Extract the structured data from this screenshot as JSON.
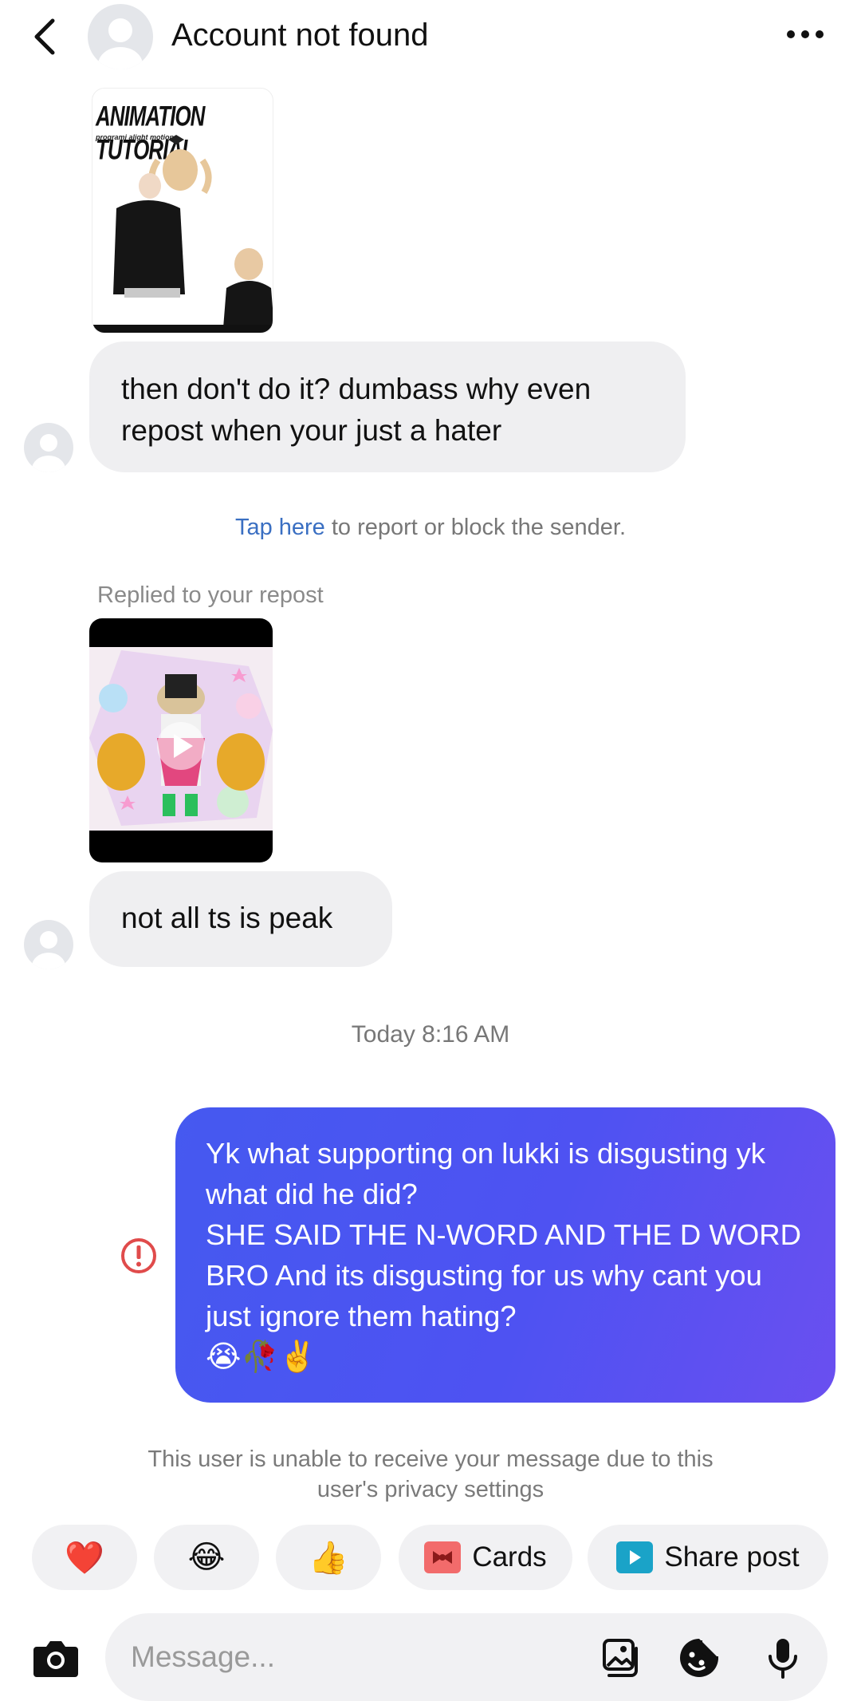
{
  "header": {
    "title": "Account not found",
    "back_icon": "chevron-left-icon",
    "more_icon": "more-horizontal-icon"
  },
  "media1": {
    "title": "ANIMATION TUTORIAL",
    "subtitle": "programi alight motion"
  },
  "messages": {
    "msg1": "then don't do it? dumbass why even repost when your just a hater",
    "report_link": "Tap here",
    "report_rest": " to report or block the sender.",
    "replied_label": "Replied to your repost",
    "msg2": "not all ts is peak",
    "timestamp": "Today 8:16 AM",
    "outgoing_text": "Yk what supporting on lukki is disgusting yk what did he did?\nSHE SAID THE N-WORD AND THE D WORD BRO And its disgusting for us why cant you just ignore them hating?",
    "outgoing_emojis": "😭🥀✌️",
    "privacy_notice": "This user is unable to receive your message due to this user's privacy settings"
  },
  "quick_replies": {
    "heart": "❤️",
    "laugh": "😂",
    "thumb": "👍",
    "cards": "Cards",
    "share_post": "Share post"
  },
  "composer": {
    "placeholder": "Message..."
  },
  "colors": {
    "outgoing_gradient_start": "#4559f0",
    "outgoing_gradient_end": "#6a4ff0",
    "incoming_bubble": "#efeff1",
    "link": "#3a6fc2",
    "error": "#e04b4b"
  }
}
